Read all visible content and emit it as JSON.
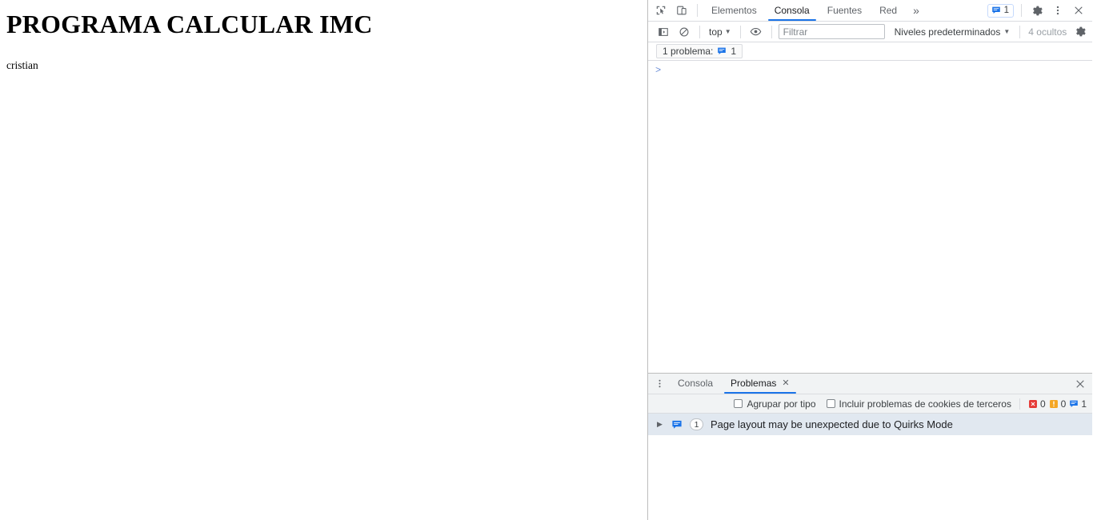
{
  "page": {
    "title": "PROGRAMA CALCULAR IMC",
    "paragraph": "cristian"
  },
  "devtools": {
    "tabs": [
      {
        "label": "Elementos",
        "active": false
      },
      {
        "label": "Consola",
        "active": true
      },
      {
        "label": "Fuentes",
        "active": false
      },
      {
        "label": "Red",
        "active": false
      }
    ],
    "overflow_label": "»",
    "icons": {
      "inspect": "inspect-element-icon",
      "device": "device-toolbar-icon",
      "settings": "gear-icon",
      "more": "kebab-menu-icon",
      "close": "close-icon"
    },
    "issues_pill_count": "1",
    "console_toolbar": {
      "sidebar_toggle": "console-sidebar-icon",
      "clear_console": "clear-console-icon",
      "context": "top",
      "eye": "live-expression-icon",
      "filter_placeholder": "Filtrar",
      "filter_value": "",
      "levels": "Niveles predeterminados",
      "hidden": "4 ocultos",
      "settings": "gear-icon"
    },
    "problem_banner": {
      "label": "1 problema:",
      "count": "1"
    },
    "console_prompt": ">",
    "drawer": {
      "tabs": [
        {
          "label": "Consola",
          "active": false,
          "closable": false
        },
        {
          "label": "Problemas",
          "active": true,
          "closable": true
        }
      ],
      "close_label": "✕",
      "tab_close_label": "✕",
      "checkboxes": [
        {
          "label": "Agrupar por tipo",
          "checked": false
        },
        {
          "label": "Incluir problemas de cookies de terceros",
          "checked": false
        }
      ],
      "counters": {
        "errors": "0",
        "warnings": "0",
        "info": "1"
      },
      "issues": [
        {
          "count": "1",
          "text": "Page layout may be unexpected due to Quirks Mode"
        }
      ]
    }
  },
  "colors": {
    "accent": "#1a73e8",
    "error": "#e53935",
    "warning": "#f5a623",
    "info": "#1a73e8",
    "row_highlight": "#e1e8f0",
    "toolbar_bg": "#f1f3f4",
    "border": "#dadce0"
  }
}
